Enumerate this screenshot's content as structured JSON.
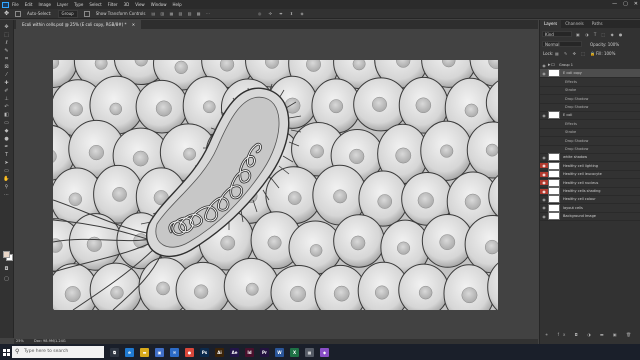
{
  "menubar": {
    "items": [
      "File",
      "Edit",
      "Image",
      "Layer",
      "Type",
      "Select",
      "Filter",
      "3D",
      "View",
      "Window",
      "Help"
    ],
    "window_controls": [
      "—",
      "▢",
      "✕"
    ]
  },
  "options_bar": {
    "auto_select_label": "Auto-Select:",
    "auto_select_value": "Group",
    "show_transform_label": "Show Transform Controls"
  },
  "document": {
    "tab_title": "Ecoli within cells.psd @ 25% (E coli copy, RGB/8#) *",
    "zoom": "25%",
    "doc_size": "Doc: 98.9M/1.24G"
  },
  "panel": {
    "tabs": [
      "Layers",
      "Channels",
      "Paths"
    ],
    "kind_label": "Kind",
    "blend_mode": "Normal",
    "opacity": "Opacity: 100%",
    "lock_label": "Lock:",
    "fill": "Fill: 100%"
  },
  "layers": [
    {
      "name": "Group 1",
      "kind": "folder",
      "eye": ""
    },
    {
      "name": "E coli copy",
      "kind": "thumb",
      "eye": "",
      "sel": true
    },
    {
      "name": "Effects",
      "kind": "sub",
      "eye": ""
    },
    {
      "name": "Stroke",
      "kind": "sub",
      "eye": ""
    },
    {
      "name": "Drop Shadow",
      "kind": "sub",
      "eye": ""
    },
    {
      "name": "Drop Shadow",
      "kind": "sub",
      "eye": ""
    },
    {
      "name": "E coli",
      "kind": "thumb",
      "eye": ""
    },
    {
      "name": "Effects",
      "kind": "sub",
      "eye": ""
    },
    {
      "name": "Stroke",
      "kind": "sub",
      "eye": ""
    },
    {
      "name": "Drop Shadow",
      "kind": "sub",
      "eye": ""
    },
    {
      "name": "Drop Shadow",
      "kind": "sub",
      "eye": ""
    },
    {
      "name": "white shadow",
      "kind": "thumb",
      "eye": ""
    },
    {
      "name": "Healthy cell lighting",
      "kind": "thumb",
      "eye": "red"
    },
    {
      "name": "Healthy cell leucocyte",
      "kind": "thumb",
      "eye": "red"
    },
    {
      "name": "Healthy cell nucleus",
      "kind": "thumb",
      "eye": "red"
    },
    {
      "name": "Healthy cells shading",
      "kind": "thumb",
      "eye": "red"
    },
    {
      "name": "Healthy cell colour",
      "kind": "thumb",
      "eye": ""
    },
    {
      "name": "layout cells",
      "kind": "thumb",
      "eye": ""
    },
    {
      "name": "Background Image",
      "kind": "thumb",
      "eye": ""
    }
  ],
  "taskbar": {
    "search_placeholder": "Type here to search",
    "icons": [
      {
        "name": "task-view",
        "label": "⧉",
        "color": "#2d3440"
      },
      {
        "name": "edge",
        "label": "e",
        "color": "#1f7ad1"
      },
      {
        "name": "folder",
        "label": "▬",
        "color": "#d7a91c"
      },
      {
        "name": "store",
        "label": "▣",
        "color": "#3f6fc7"
      },
      {
        "name": "mail",
        "label": "✉",
        "color": "#2c6bc7"
      },
      {
        "name": "chrome",
        "label": "●",
        "color": "#d9473a"
      },
      {
        "name": "photoshop",
        "label": "Ps",
        "color": "#0c2a4c"
      },
      {
        "name": "illustrator",
        "label": "Ai",
        "color": "#3a2308"
      },
      {
        "name": "aftereffects",
        "label": "Ae",
        "color": "#221448"
      },
      {
        "name": "indesign",
        "label": "Id",
        "color": "#49102c"
      },
      {
        "name": "premiere",
        "label": "Pr",
        "color": "#23123f"
      },
      {
        "name": "word",
        "label": "W",
        "color": "#2a5699"
      },
      {
        "name": "excel",
        "label": "X",
        "color": "#1e7145"
      },
      {
        "name": "app1",
        "label": "▦",
        "color": "#555b66"
      },
      {
        "name": "app2",
        "label": "◆",
        "color": "#8a4fc8"
      }
    ],
    "tray_time": "",
    "tray_date": ""
  },
  "colors": {
    "accent": "#31a8ff",
    "visibility_red": "#b23a2e"
  }
}
